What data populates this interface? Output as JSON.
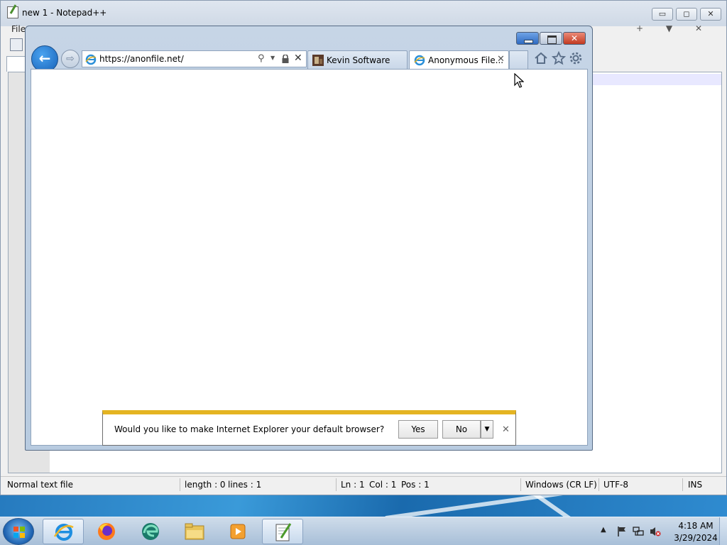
{
  "notepad": {
    "title": "new 1 - Notepad++",
    "menu_file": "File",
    "menu_right": "+ ▼ ✕",
    "window_min": "▭",
    "window_max": "◻",
    "window_close": "✕",
    "status": {
      "file_type": "Normal text file",
      "length": "length : 0",
      "lines": "lines : 1",
      "ln": "Ln : 1",
      "col": "Col : 1",
      "pos": "Pos : 1",
      "eol": "Windows (CR LF)",
      "encoding": "UTF-8",
      "mode": "INS"
    }
  },
  "ie": {
    "address": "https://anonfile.net/",
    "back_arrow": "←",
    "forward_arrow": "⇨",
    "close_glyph": "✕",
    "search_glyph": "⚲",
    "dropdown_glyph": "▼",
    "tabs": [
      {
        "label": "Kevin Software",
        "icon": "kevin-software-favicon"
      },
      {
        "label": "Anonymous File...",
        "icon": "ie-page-icon",
        "close": "✕"
      }
    ],
    "notification": {
      "message": "Would you like to make Internet Explorer your default browser?",
      "yes": "Yes",
      "no": "No",
      "dropdown": "▼",
      "close": "✕"
    }
  },
  "taskbar": {
    "apps": [
      "internet-explorer",
      "firefox",
      "edge-beta",
      "file-explorer",
      "media-player",
      "notepad-plus-plus"
    ],
    "active_app": "internet-explorer",
    "tray_up": "▲",
    "time": "4:18 AM",
    "date": "3/29/2024"
  },
  "colors": {
    "notif_accent": "#e4b422",
    "ie_frame": "#c6d5e6",
    "taskbar": "#b8cbe0"
  }
}
